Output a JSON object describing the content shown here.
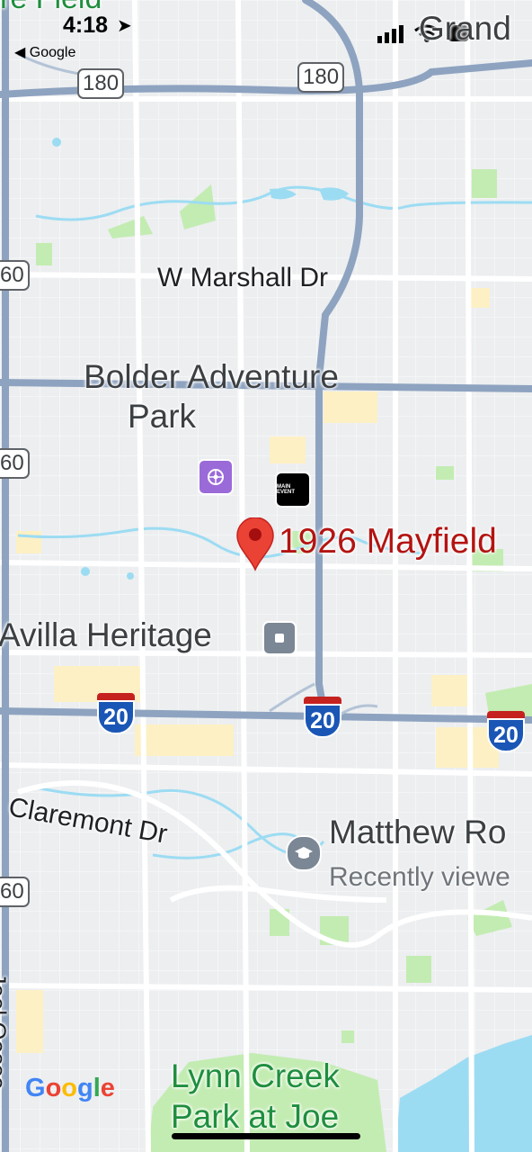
{
  "status_bar": {
    "time": "4:18",
    "back_label": "◀ Google"
  },
  "map": {
    "street_labels": {
      "marshall": "W Marshall Dr",
      "claremont": "Claremont Dr"
    },
    "places": {
      "bolder": "Bolder Adventure Park",
      "bolder_line1": "Bolder Adventure",
      "bolder_line2": "Park",
      "avilla": "Avilla Heritage",
      "matthew": "Matthew Ro",
      "matthew_sub": "Recently viewe",
      "lynn_line1": "Lynn Creek",
      "lynn_line2": "Park at Joe",
      "top_left_cut": "re Field",
      "top_right_cut": "Grand",
      "left_street_cut": "Joel Oosso"
    },
    "pin": {
      "label": "1926 Mayfield",
      "color": "#ea4335"
    },
    "shields": {
      "hwy180_a": "180",
      "hwy180_b": "180",
      "hwy360_a": "60",
      "hwy360_b": "60",
      "hwy360_c": "60",
      "i20_a": "20",
      "i20_b": "20",
      "i20_c": "20"
    },
    "poi_main_event": "MAIN EVENT",
    "colors": {
      "land": "#eceef0",
      "park": "#c3ecb2",
      "water": "#9cdcf3",
      "highway": "#8ea3c0",
      "commercial": "#fdf0c4",
      "pin": "#ea4335",
      "interstate_blue": "#1a56b5"
    },
    "attribution": "Google"
  }
}
